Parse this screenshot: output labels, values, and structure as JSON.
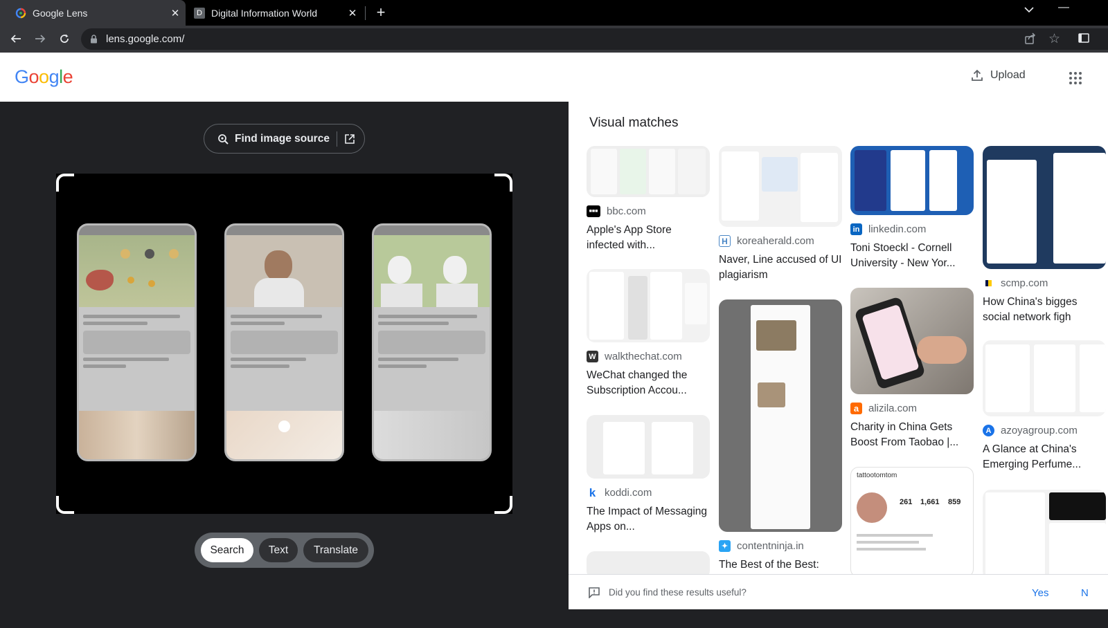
{
  "browser": {
    "tabs": [
      {
        "title": "Google Lens",
        "icon": "google-lens-favicon"
      },
      {
        "title": "Digital Information World",
        "icon": "D"
      }
    ],
    "url": "lens.google.com/"
  },
  "header": {
    "logo_letters": [
      "G",
      "o",
      "o",
      "g",
      "l",
      "e"
    ],
    "logo_colors": [
      "#4285F4",
      "#EA4335",
      "#FBBC05",
      "#4285F4",
      "#34A853",
      "#EA4335"
    ],
    "upload_label": "Upload"
  },
  "left": {
    "find_source_label": "Find image source",
    "modes": [
      "Search",
      "Text",
      "Translate"
    ],
    "selected_mode": "Search"
  },
  "right": {
    "section_title": "Visual matches",
    "results": [
      {
        "site": "bbc.com",
        "title": "Apple's App Store infected with..."
      },
      {
        "site": "walkthechat.com",
        "title": "WeChat changed the Subscription Accou..."
      },
      {
        "site": "koddi.com",
        "title": "The Impact of Messaging Apps on..."
      },
      {
        "site": "koreaherald.com",
        "title": "Naver, Line accused of UI plagiarism"
      },
      {
        "site": "contentninja.in",
        "title": "The Best of the Best:"
      },
      {
        "site": "linkedin.com",
        "title": "Toni Stoeckl - Cornell University - New Yor..."
      },
      {
        "site": "alizila.com",
        "title": "Charity in China Gets Boost From Taobao |..."
      },
      {
        "site": "scmp.com",
        "title": "How China's bigges social network figh"
      },
      {
        "site": "azoyagroup.com",
        "title": "A Glance at China's Emerging Perfume..."
      }
    ],
    "profile_mock": {
      "handle": "tattootomtom",
      "stats": [
        "261",
        "1,661",
        "859"
      ]
    }
  },
  "feedback": {
    "question": "Did you find these results useful?",
    "yes": "Yes",
    "no": "N"
  }
}
